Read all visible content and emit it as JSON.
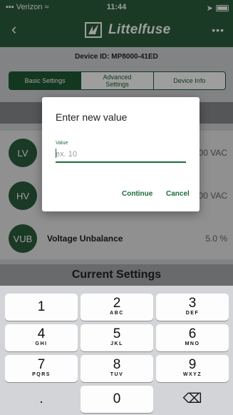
{
  "status_bar": {
    "carrier": "Verizon",
    "time": "11:44"
  },
  "nav": {
    "brand": "Littelfuse"
  },
  "device": {
    "id_label": "Device ID: MP8000-41ED"
  },
  "tabs": [
    {
      "label": "Basic Settings"
    },
    {
      "label": "Advanced Settings"
    },
    {
      "label": "Device Info"
    }
  ],
  "voltage_rows": [
    {
      "abbr": "LV",
      "label": "",
      "value": "00 VAC"
    },
    {
      "abbr": "HV",
      "label": "",
      "value": "00 VAC"
    },
    {
      "abbr": "VUB",
      "label": "Voltage Unbalance",
      "value": "5.0 %"
    }
  ],
  "current_header": "Current Settings",
  "dialog": {
    "title": "Enter new value",
    "field_label": "Value",
    "placeholder": "ex. 10",
    "continue_label": "Continue",
    "cancel_label": "Cancel"
  },
  "keypad": [
    {
      "num": "1",
      "letters": ""
    },
    {
      "num": "2",
      "letters": "ABC"
    },
    {
      "num": "3",
      "letters": "DEF"
    },
    {
      "num": "4",
      "letters": "GHI"
    },
    {
      "num": "5",
      "letters": "JKL"
    },
    {
      "num": "6",
      "letters": "MNO"
    },
    {
      "num": "7",
      "letters": "PQRS"
    },
    {
      "num": "8",
      "letters": "TUV"
    },
    {
      "num": "9",
      "letters": "WXYZ"
    },
    {
      "num": ".",
      "letters": ""
    },
    {
      "num": "0",
      "letters": ""
    },
    {
      "num": "⌫",
      "letters": ""
    }
  ],
  "colors": {
    "brand_green": "#2a5e3c",
    "accent_green": "#1f6a3b"
  }
}
